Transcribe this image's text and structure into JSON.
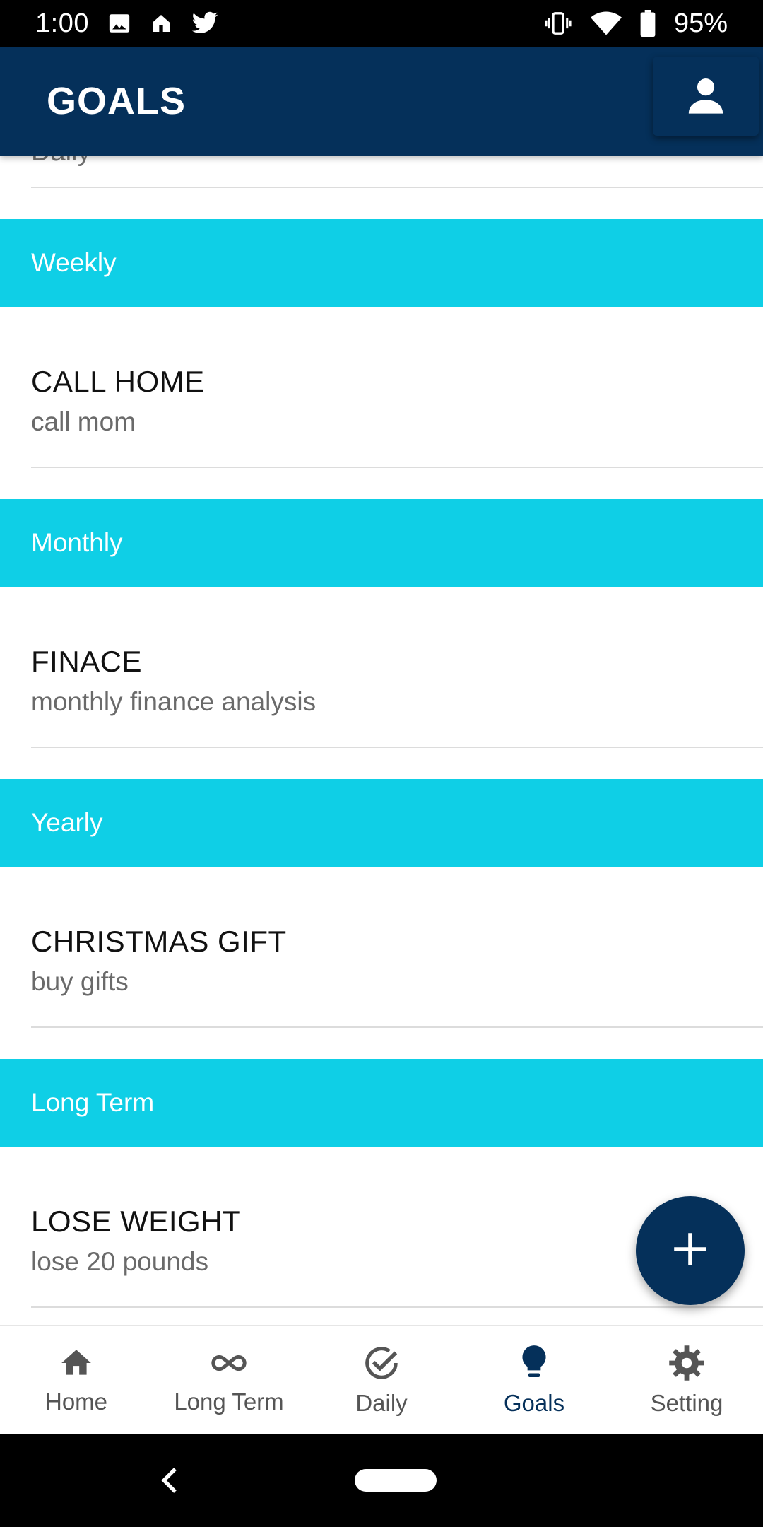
{
  "status_bar": {
    "time": "1:00",
    "battery_pct": "95%",
    "icons_left": [
      "image-icon",
      "home-notif-icon",
      "twitter-icon"
    ],
    "icons_right": [
      "vibrate-icon",
      "wifi-icon",
      "battery-icon"
    ]
  },
  "app_bar": {
    "title": "GOALS",
    "profile_icon": "person-icon"
  },
  "list": {
    "partial_item_text": "Daily",
    "sections": [
      {
        "header": "Weekly",
        "items": [
          {
            "title": "CALL HOME",
            "subtitle": "call mom"
          }
        ]
      },
      {
        "header": "Monthly",
        "items": [
          {
            "title": "FINACE",
            "subtitle": "monthly finance analysis"
          }
        ]
      },
      {
        "header": "Yearly",
        "items": [
          {
            "title": "CHRISTMAS GIFT",
            "subtitle": "buy gifts"
          }
        ]
      },
      {
        "header": "Long Term",
        "items": [
          {
            "title": "LOSE WEIGHT",
            "subtitle": "lose 20 pounds"
          }
        ]
      }
    ]
  },
  "fab": {
    "icon": "plus-icon"
  },
  "bottom_nav": {
    "items": [
      {
        "label": "Home",
        "icon": "home-icon",
        "active": false
      },
      {
        "label": "Long Term",
        "icon": "infinity-icon",
        "active": false
      },
      {
        "label": "Daily",
        "icon": "check-circle-icon",
        "active": false
      },
      {
        "label": "Goals",
        "icon": "lightbulb-icon",
        "active": true
      },
      {
        "label": "Setting",
        "icon": "gear-icon",
        "active": false
      }
    ]
  },
  "colors": {
    "primary": "#05305a",
    "section_header": "#0fcfe6",
    "active_nav": "#05305a",
    "inactive_nav": "#555555"
  }
}
